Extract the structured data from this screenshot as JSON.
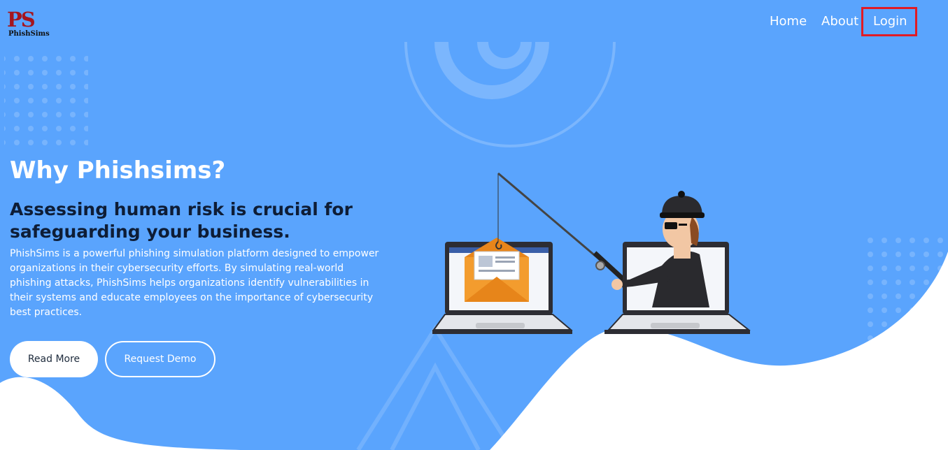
{
  "brand": {
    "logo_letters": "PS",
    "logo_name": "PhishSims"
  },
  "nav": {
    "items": [
      "Home",
      "About",
      "Login"
    ]
  },
  "hero": {
    "title": "Why Phishsims?",
    "subtitle": "Assessing human risk is crucial for safeguarding your business.",
    "description": "PhishSims is a powerful phishing simulation platform designed to empower organizations in their cybersecurity efforts. By simulating real-world phishing attacks, PhishSims helps organizations identify vulnerabilities in their systems and educate employees on the importance of cybersecurity best practices."
  },
  "buttons": {
    "read_more": "Read More",
    "request_demo": "Request Demo"
  },
  "colors": {
    "background": "#5aa4fd",
    "highlight": "#e11b24",
    "subtitle": "#0e1d36",
    "logo": "#a5161f"
  },
  "icons": [
    "dot-grid-decoration",
    "arc-decoration",
    "triangle-decoration",
    "laptop-icon",
    "email-envelope-icon",
    "fishing-rod-icon",
    "hacker-figure-icon"
  ]
}
